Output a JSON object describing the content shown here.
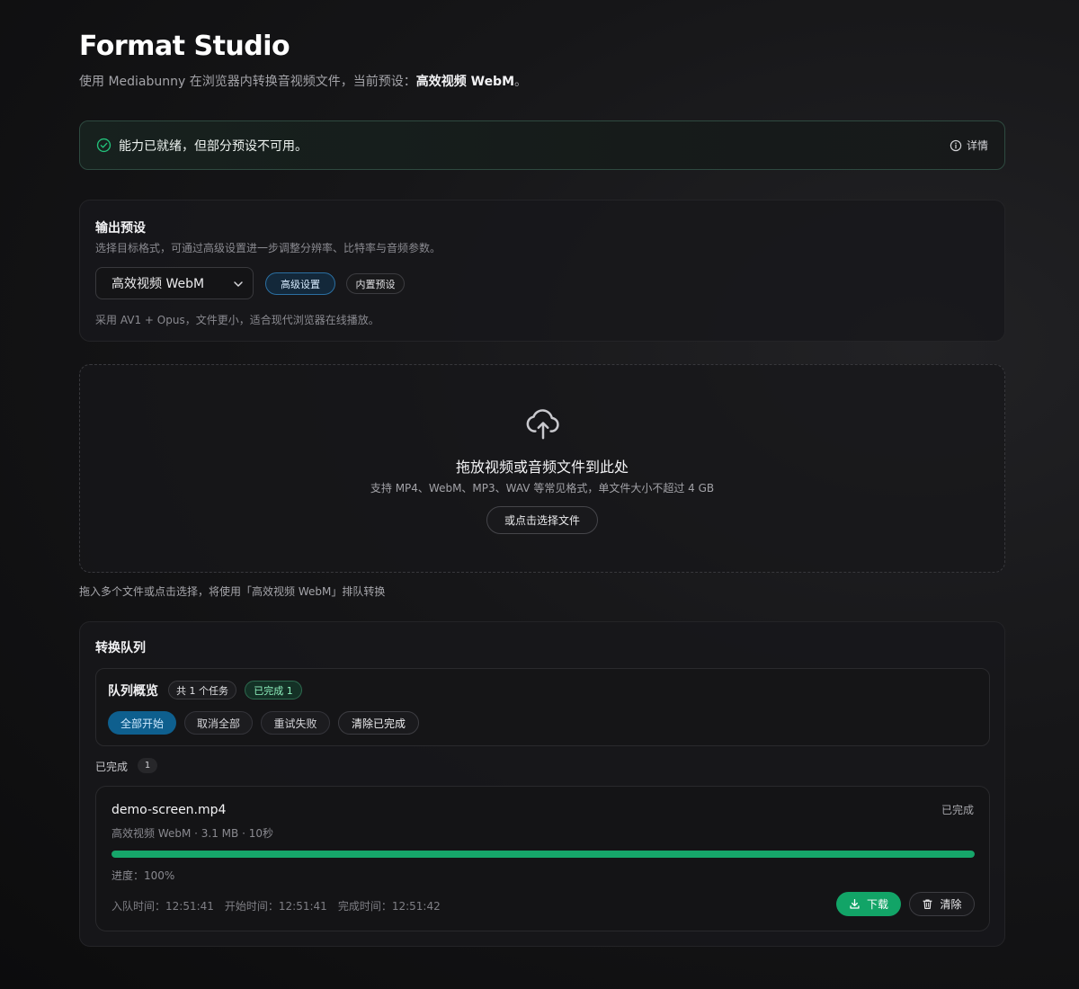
{
  "header": {
    "title": "Format Studio",
    "subtitle_prefix": "使用 Mediabunny 在浏览器内转换音视频文件，当前预设：",
    "subtitle_preset": "高效视频 WebM",
    "subtitle_suffix": "。"
  },
  "banner": {
    "icon": "check-circle-icon",
    "message": "能力已就绪，但部分预设不可用。",
    "details_icon": "info-icon",
    "details_label": "详情",
    "accent_color": "#22c07a"
  },
  "preset": {
    "heading": "输出预设",
    "description": "选择目标格式，可通过高级设置进一步调整分辨率、比特率与音频参数。",
    "selected": "高效视频 WebM",
    "advanced_label": "高级设置",
    "builtin_label": "内置预设",
    "note": "采用 AV1 + Opus，文件更小，适合现代浏览器在线播放。"
  },
  "dropzone": {
    "icon": "cloud-upload-icon",
    "heading": "拖放视频或音频文件到此处",
    "subtext": "支持 MP4、WebM、MP3、WAV 等常见格式，单文件大小不超过 4 GB",
    "pick_label": "或点击选择文件",
    "hint": "拖入多个文件或点击选择，将使用「高效视频 WebM」排队转换"
  },
  "queue": {
    "heading": "转换队列",
    "overview": {
      "heading": "队列概览",
      "total_badge": "共 1 个任务",
      "done_badge": "已完成 1",
      "actions": {
        "start_all": "全部开始",
        "cancel_all": "取消全部",
        "retry_failed": "重试失败",
        "clear_completed": "清除已完成"
      }
    },
    "group": {
      "label": "已完成",
      "count": "1"
    },
    "jobs": [
      {
        "filename": "demo-screen.mp4",
        "meta": "高效视频 WebM · 3.1 MB · 10秒",
        "status": "已完成",
        "progress_fraction": 1.0,
        "progress_text": "进度：100%",
        "enqueued": "入队时间：12:51:41",
        "started": "开始时间：12:51:41",
        "finished": "完成时间：12:51:42",
        "download_label": "下载",
        "clear_label": "清除",
        "progress_color": "#16a66a"
      }
    ]
  }
}
